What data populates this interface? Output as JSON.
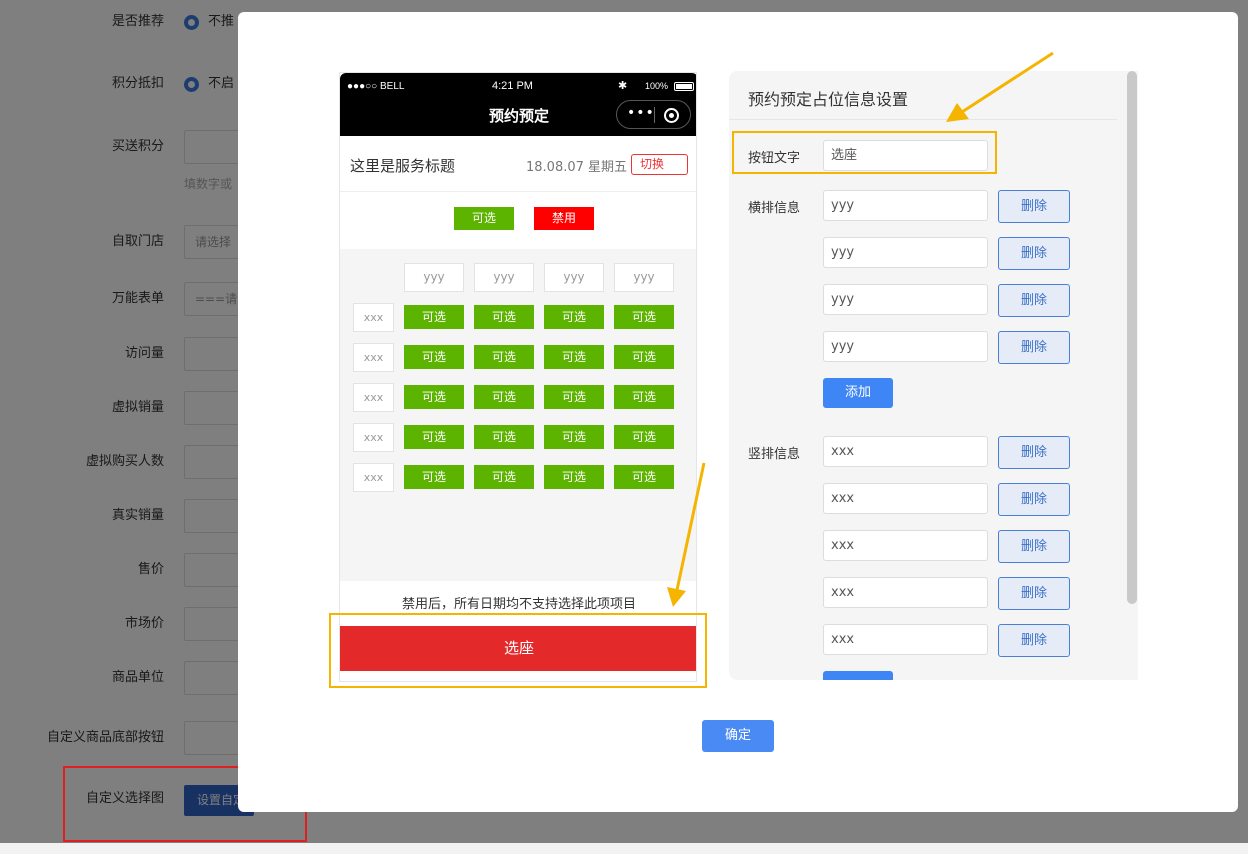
{
  "background_form": {
    "recommend_label": "是否推荐",
    "recommend_value": "不推",
    "points_deduct_label": "积分抵扣",
    "points_deduct_value": "不启",
    "gift_points_label": "买送积分",
    "gift_points_hint": "填数字或",
    "pickup_store_label": "自取门店",
    "pickup_store_value": "请选择",
    "universal_form_label": "万能表单",
    "universal_form_value": "===请",
    "visits_label": "访问量",
    "virtual_sales_label": "虚拟销量",
    "virtual_buyers_label": "虚拟购买人数",
    "real_sales_label": "真实销量",
    "price_label": "售价",
    "market_price_label": "市场价",
    "unit_label": "商品单位",
    "custom_bottom_btn_label": "自定义商品底部按钮",
    "custom_select_label": "自定义选择图",
    "custom_select_button": "设置自定"
  },
  "phone": {
    "carrier": "●●●○○ BELL",
    "time": "4:21 PM",
    "battery": "100%",
    "nav_title": "预约预定",
    "capsule_more": "•••",
    "service_title": "这里是服务标题",
    "date": "18.08.07 星期五",
    "switch_label": "切换",
    "legend_available": "可选",
    "legend_disabled": "禁用",
    "columns": [
      "yyy",
      "yyy",
      "yyy",
      "yyy"
    ],
    "rows": [
      "xxx",
      "xxx",
      "xxx",
      "xxx",
      "xxx"
    ],
    "cell_label": "可选",
    "note": "禁用后，所有日期均不支持选择此项项目",
    "action_button": "选座"
  },
  "settings": {
    "title": "预约预定占位信息设置",
    "button_text_label": "按钮文字",
    "button_text_value": "选座",
    "horizontal_label": "横排信息",
    "horizontal_items": [
      "yyy",
      "yyy",
      "yyy",
      "yyy"
    ],
    "vertical_label": "竖排信息",
    "vertical_items": [
      "xxx",
      "xxx",
      "xxx",
      "xxx",
      "xxx"
    ],
    "delete_label": "删除",
    "add_label": "添加"
  },
  "confirm_label": "确定",
  "colors": {
    "available_green": "#5cb300",
    "disabled_red": "#ff0000",
    "action_red": "#e4292b",
    "primary_blue": "#3e86f5",
    "highlight_yellow": "#f5b400"
  }
}
